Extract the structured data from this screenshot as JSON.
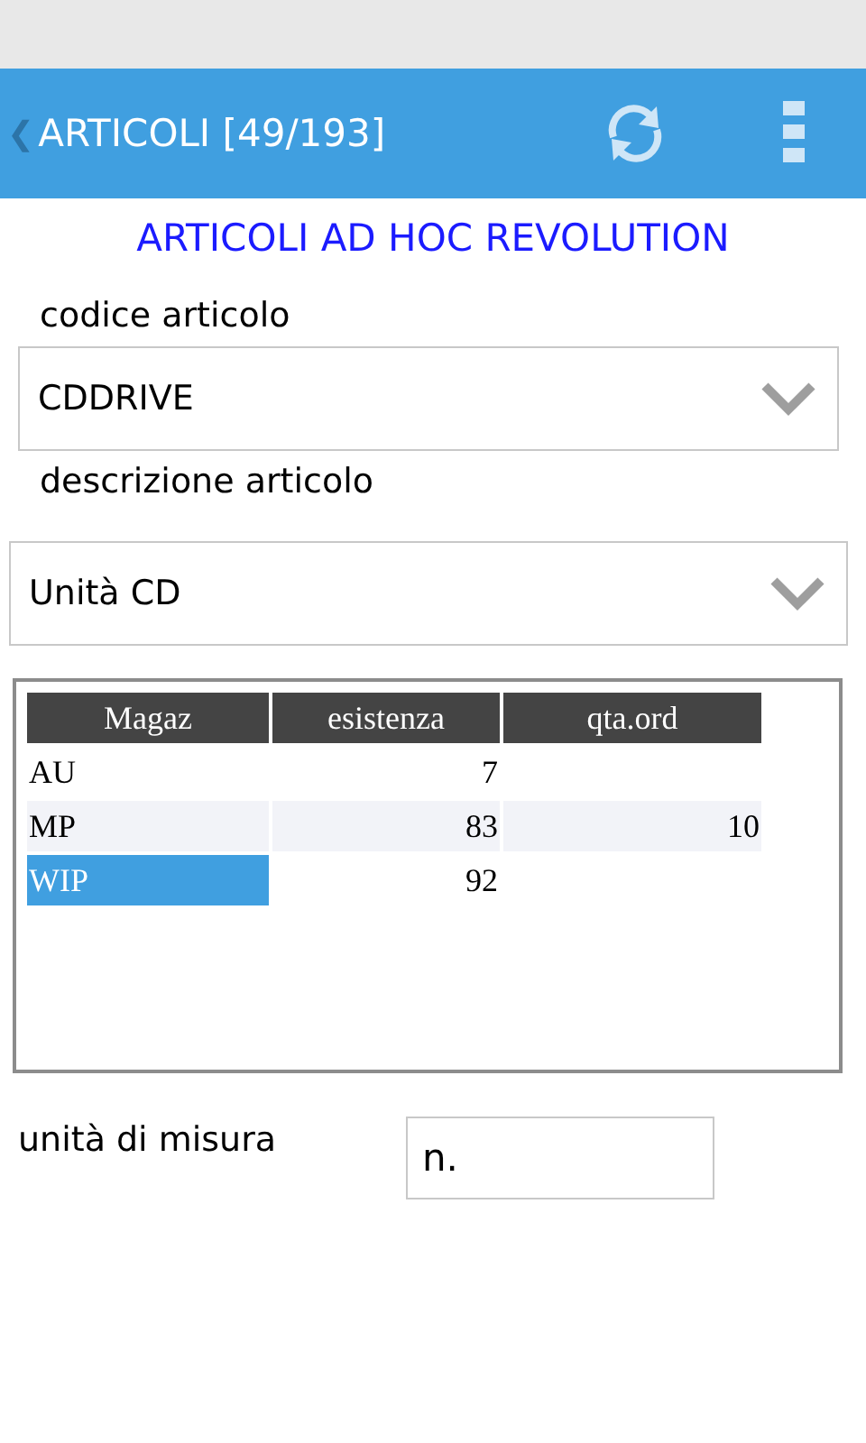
{
  "app_bar": {
    "back": "❮",
    "title": "ARTICOLI [49/193]"
  },
  "heading": "ARTICOLI AD HOC REVOLUTION",
  "fields": [
    {
      "label": "codice articolo",
      "value": "CDDRIVE"
    },
    {
      "label": "descrizione articolo",
      "value": "Unità CD"
    }
  ],
  "table": {
    "columns": [
      "Magaz",
      "esistenza",
      "qta.ord"
    ],
    "rows": [
      {
        "cells": [
          "AU",
          "7"
        ],
        "selected": false
      },
      {
        "cells": [
          "MP",
          "83",
          "10"
        ],
        "selected": false
      },
      {
        "cells": [
          "WIP",
          "92"
        ],
        "selected": true
      }
    ]
  },
  "unit": {
    "label": "unità di misura",
    "value": "n."
  }
}
